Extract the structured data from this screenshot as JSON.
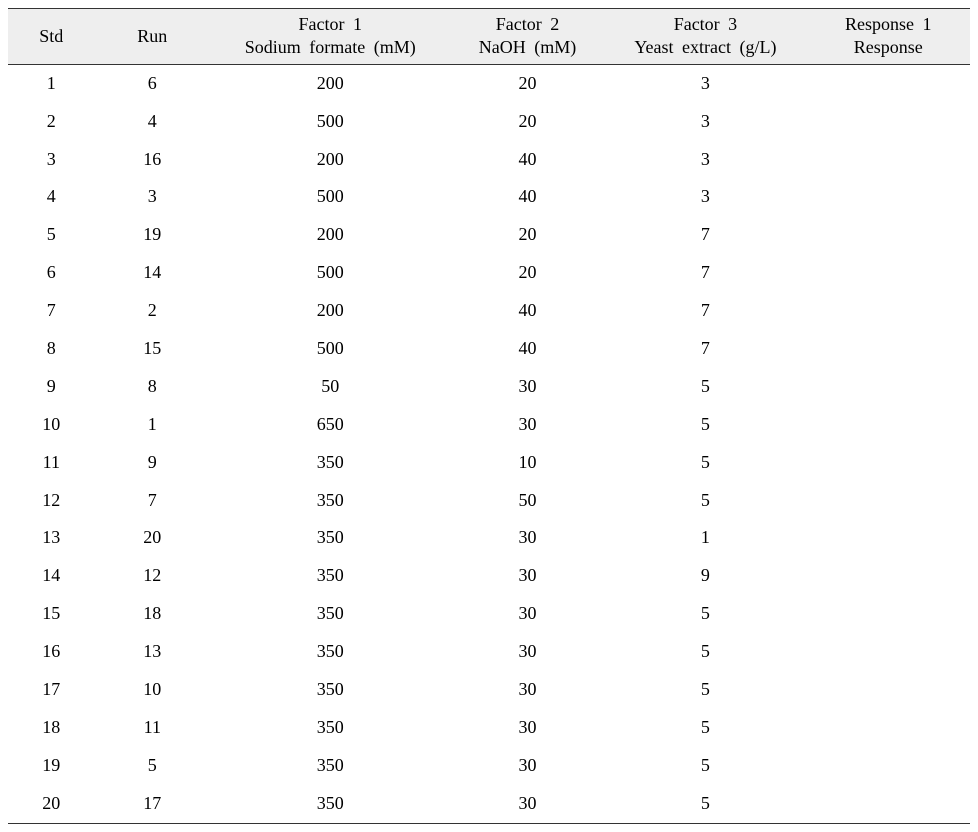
{
  "headers": {
    "std": "Std",
    "run": "Run",
    "f1_line1": "Factor 1",
    "f1_line2": "Sodium formate (mM)",
    "f2_line1": "Factor 2",
    "f2_line2": "NaOH (mM)",
    "f3_line1": "Factor 3",
    "f3_line2": "Yeast extract (g/L)",
    "r1_line1": "Response 1",
    "r1_line2": "Response"
  },
  "rows": [
    {
      "std": "1",
      "run": "6",
      "f1": "200",
      "f2": "20",
      "f3": "3",
      "r1": ""
    },
    {
      "std": "2",
      "run": "4",
      "f1": "500",
      "f2": "20",
      "f3": "3",
      "r1": ""
    },
    {
      "std": "3",
      "run": "16",
      "f1": "200",
      "f2": "40",
      "f3": "3",
      "r1": ""
    },
    {
      "std": "4",
      "run": "3",
      "f1": "500",
      "f2": "40",
      "f3": "3",
      "r1": ""
    },
    {
      "std": "5",
      "run": "19",
      "f1": "200",
      "f2": "20",
      "f3": "7",
      "r1": ""
    },
    {
      "std": "6",
      "run": "14",
      "f1": "500",
      "f2": "20",
      "f3": "7",
      "r1": ""
    },
    {
      "std": "7",
      "run": "2",
      "f1": "200",
      "f2": "40",
      "f3": "7",
      "r1": ""
    },
    {
      "std": "8",
      "run": "15",
      "f1": "500",
      "f2": "40",
      "f3": "7",
      "r1": ""
    },
    {
      "std": "9",
      "run": "8",
      "f1": "50",
      "f2": "30",
      "f3": "5",
      "r1": ""
    },
    {
      "std": "10",
      "run": "1",
      "f1": "650",
      "f2": "30",
      "f3": "5",
      "r1": ""
    },
    {
      "std": "11",
      "run": "9",
      "f1": "350",
      "f2": "10",
      "f3": "5",
      "r1": ""
    },
    {
      "std": "12",
      "run": "7",
      "f1": "350",
      "f2": "50",
      "f3": "5",
      "r1": ""
    },
    {
      "std": "13",
      "run": "20",
      "f1": "350",
      "f2": "30",
      "f3": "1",
      "r1": ""
    },
    {
      "std": "14",
      "run": "12",
      "f1": "350",
      "f2": "30",
      "f3": "9",
      "r1": ""
    },
    {
      "std": "15",
      "run": "18",
      "f1": "350",
      "f2": "30",
      "f3": "5",
      "r1": ""
    },
    {
      "std": "16",
      "run": "13",
      "f1": "350",
      "f2": "30",
      "f3": "5",
      "r1": ""
    },
    {
      "std": "17",
      "run": "10",
      "f1": "350",
      "f2": "30",
      "f3": "5",
      "r1": ""
    },
    {
      "std": "18",
      "run": "11",
      "f1": "350",
      "f2": "30",
      "f3": "5",
      "r1": ""
    },
    {
      "std": "19",
      "run": "5",
      "f1": "350",
      "f2": "30",
      "f3": "5",
      "r1": ""
    },
    {
      "std": "20",
      "run": "17",
      "f1": "350",
      "f2": "30",
      "f3": "5",
      "r1": ""
    }
  ]
}
